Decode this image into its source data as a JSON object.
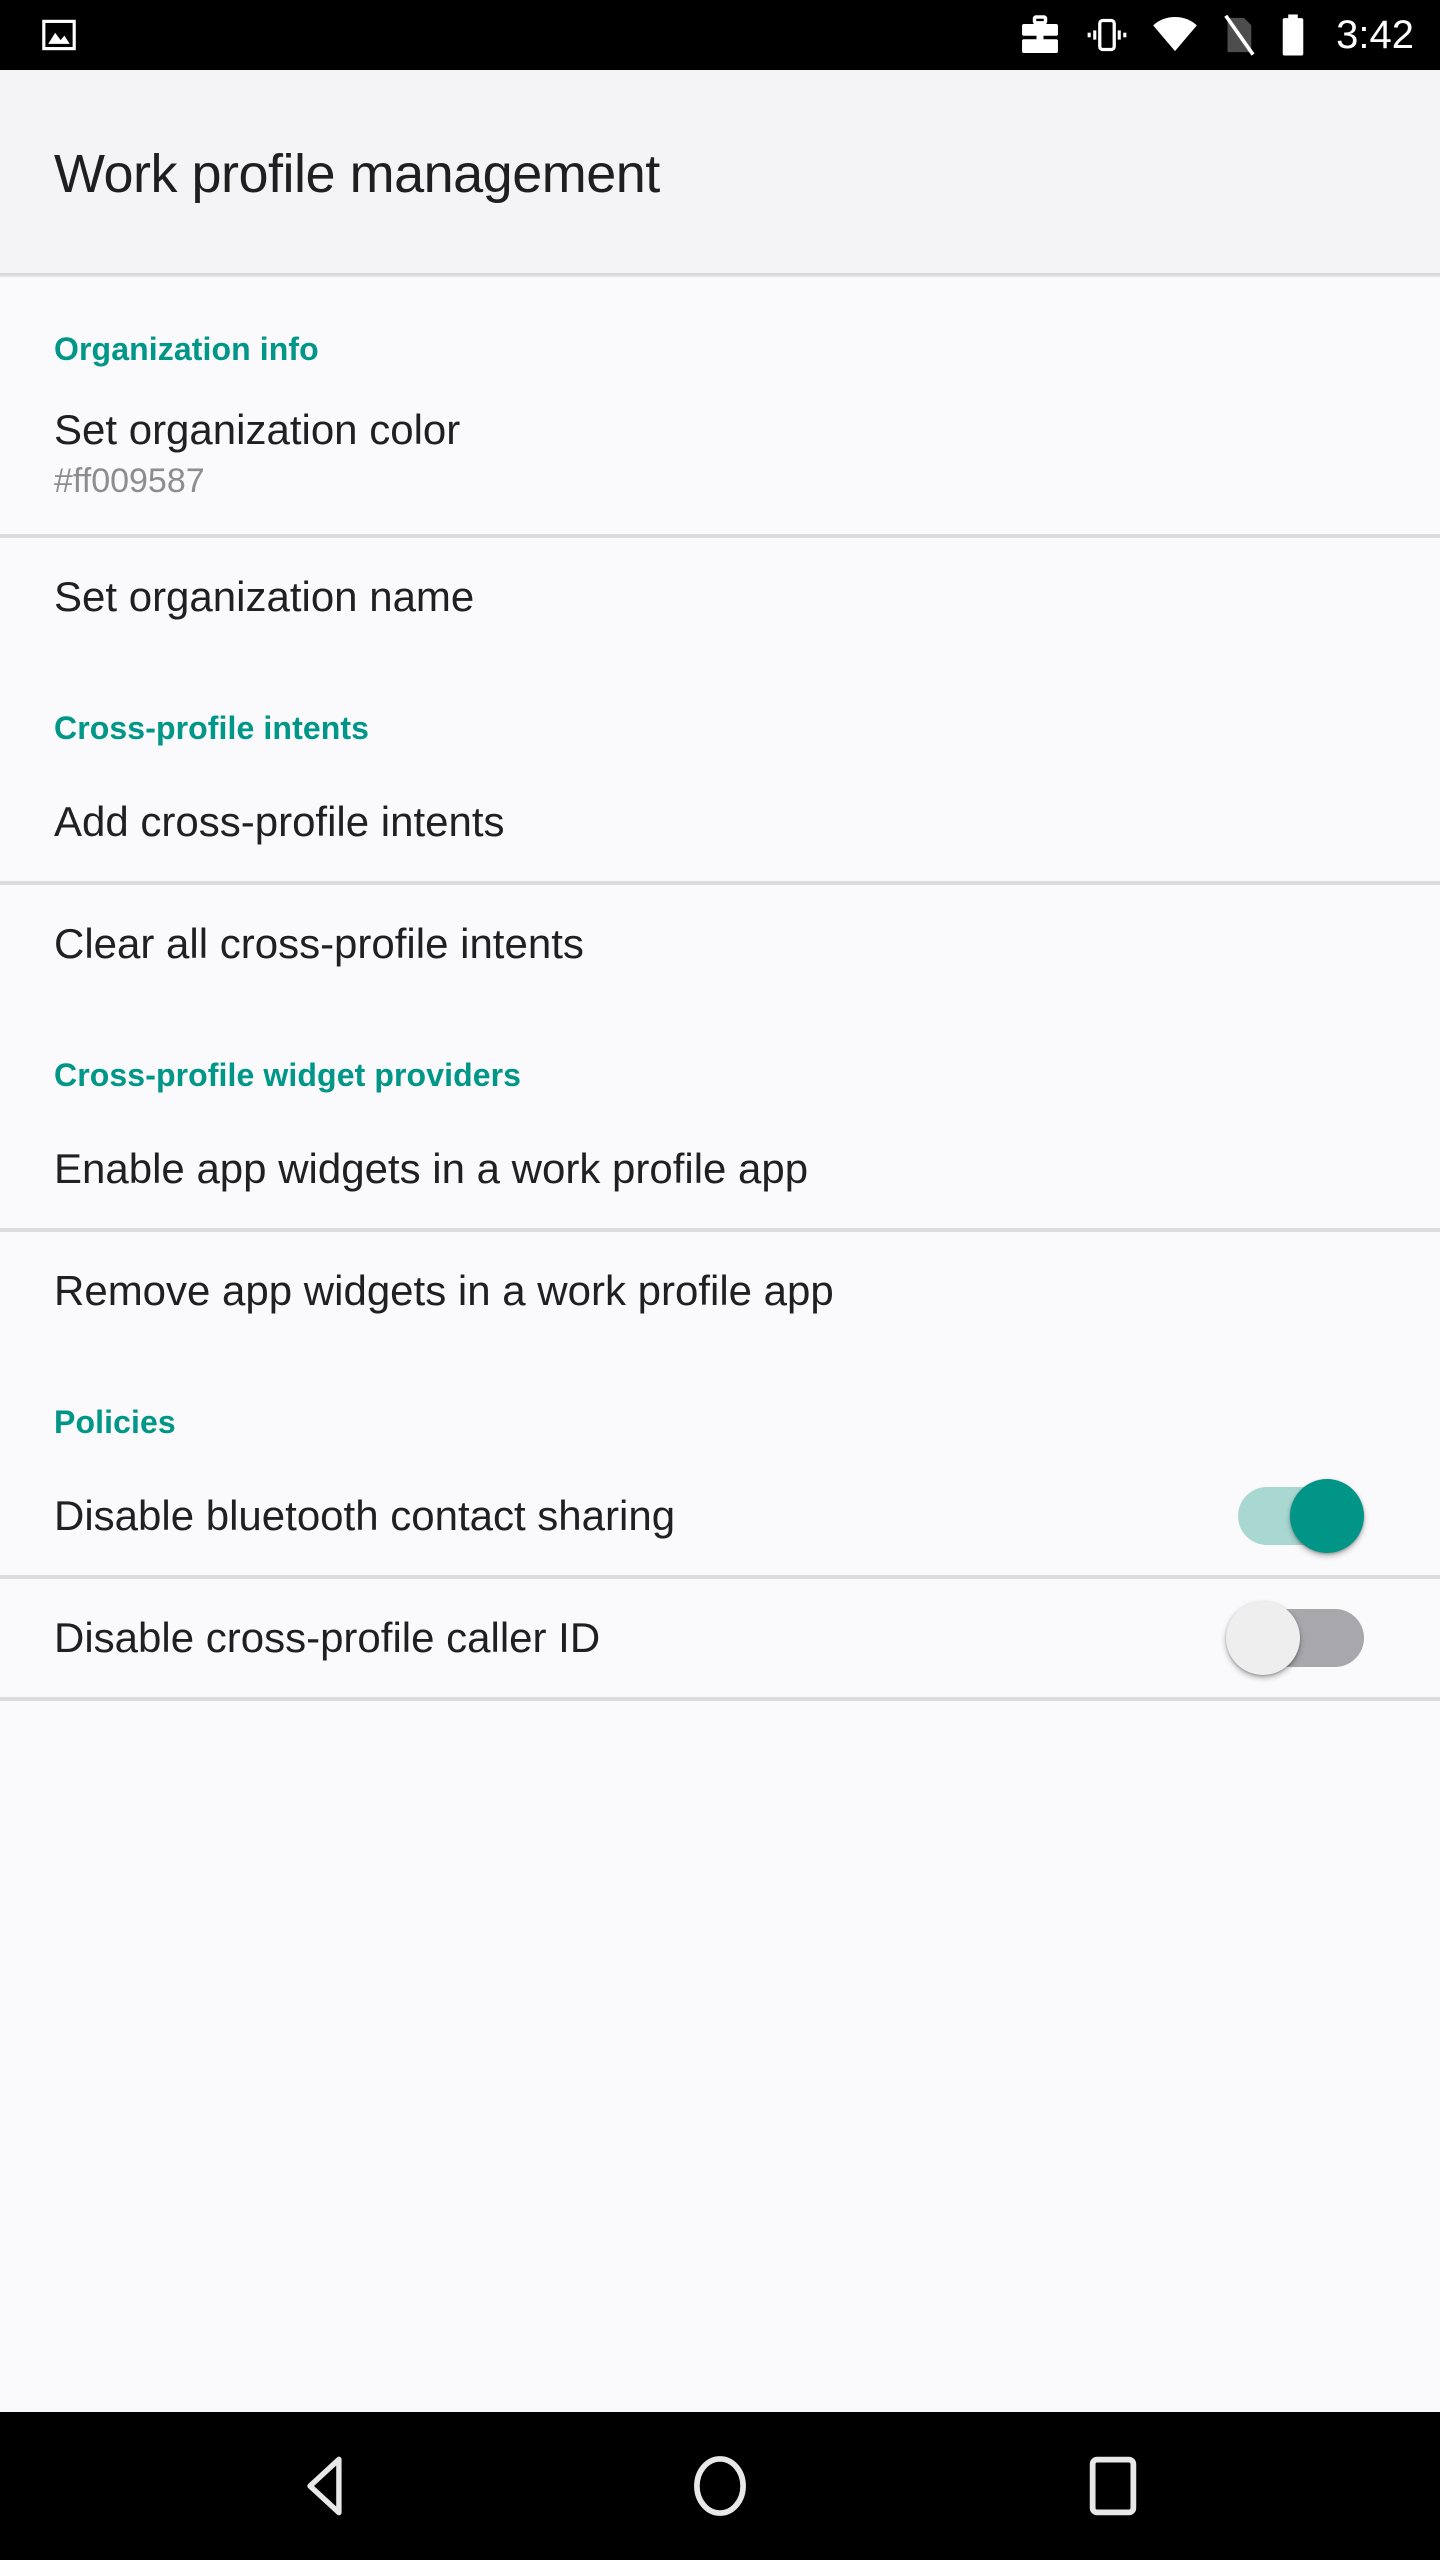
{
  "status_bar": {
    "notification_icons": [
      "screenshot-image-icon"
    ],
    "system_icons": [
      "work-profile-briefcase-icon",
      "vibrate-icon",
      "wifi-icon",
      "no-sim-icon",
      "battery-full-icon"
    ],
    "clock": "3:42"
  },
  "header": {
    "title": "Work profile management"
  },
  "theme": {
    "accent": "#009688",
    "switch_on_thumb": "#009587",
    "switch_on_track": "#a9d8d3",
    "switch_off_thumb": "#eeeeef",
    "switch_off_track": "#a7a7ac",
    "page_background": "#faf9fb",
    "title_background": "#f4f3f6",
    "divider": "#dcdbde",
    "primary_text": "#202020",
    "secondary_text": "#8d8d8d"
  },
  "sections": [
    {
      "header": "Organization info",
      "rows": [
        {
          "title": "Set organization color",
          "subtitle": "#ff009587",
          "control": "none",
          "divider_after": true
        },
        {
          "title": "Set organization name",
          "subtitle": "",
          "control": "none",
          "divider_after": false
        }
      ]
    },
    {
      "header": "Cross-profile intents",
      "rows": [
        {
          "title": "Add cross-profile intents",
          "subtitle": "",
          "control": "none",
          "divider_after": true
        },
        {
          "title": "Clear all cross-profile intents",
          "subtitle": "",
          "control": "none",
          "divider_after": false
        }
      ]
    },
    {
      "header": "Cross-profile widget providers",
      "rows": [
        {
          "title": "Enable app widgets in a work profile app",
          "subtitle": "",
          "control": "none",
          "divider_after": true
        },
        {
          "title": "Remove app widgets in a work profile app",
          "subtitle": "",
          "control": "none",
          "divider_after": false
        }
      ]
    },
    {
      "header": "Policies",
      "rows": [
        {
          "title": "Disable bluetooth contact sharing",
          "subtitle": "",
          "control": "switch",
          "checked": true,
          "divider_after": true
        },
        {
          "title": "Disable cross-profile caller ID",
          "subtitle": "",
          "control": "switch",
          "checked": false,
          "divider_after": true
        }
      ]
    }
  ],
  "nav_bar": {
    "buttons": [
      {
        "name": "back-button",
        "icon": "back-triangle-icon"
      },
      {
        "name": "home-button",
        "icon": "home-circle-icon"
      },
      {
        "name": "recents-button",
        "icon": "recents-square-icon"
      }
    ]
  }
}
